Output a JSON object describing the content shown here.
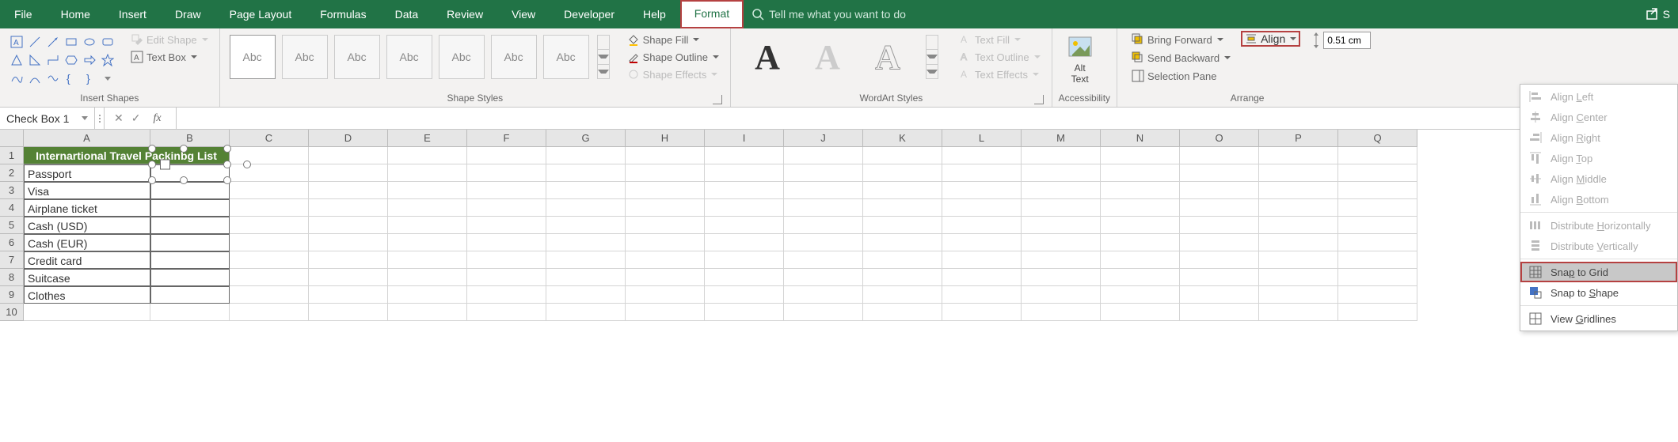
{
  "menu": {
    "tabs": [
      "File",
      "Home",
      "Insert",
      "Draw",
      "Page Layout",
      "Formulas",
      "Data",
      "Review",
      "View",
      "Developer",
      "Help",
      "Format"
    ],
    "active": "Format",
    "tellme_placeholder": "Tell me what you want to do",
    "share": "S"
  },
  "ribbon": {
    "insert_shapes": {
      "edit_shape": "Edit Shape",
      "text_box": "Text Box",
      "label": "Insert Shapes"
    },
    "shape_styles": {
      "swatch_text": "Abc",
      "fill": "Shape Fill",
      "outline": "Shape Outline",
      "effects": "Shape Effects",
      "label": "Shape Styles"
    },
    "wordart": {
      "glyph": "A",
      "fill": "Text Fill",
      "outline": "Text Outline",
      "effects": "Text Effects",
      "label": "WordArt Styles"
    },
    "accessibility": {
      "alt": "Alt\nText",
      "label": "Accessibility"
    },
    "arrange": {
      "bring_forward": "Bring Forward",
      "send_backward": "Send Backward",
      "selection_pane": "Selection Pane",
      "align": "Align",
      "label": "Arrange"
    },
    "size": {
      "height": "0.51 cm"
    }
  },
  "align_menu": {
    "items": [
      {
        "label": "Align Left",
        "u": "L"
      },
      {
        "label": "Align Center",
        "u": "C"
      },
      {
        "label": "Align Right",
        "u": "R"
      },
      {
        "label": "Align Top",
        "u": "T"
      },
      {
        "label": "Align Middle",
        "u": "M"
      },
      {
        "label": "Align Bottom",
        "u": "B"
      },
      {
        "label": "Distribute Horizontally",
        "u": "H"
      },
      {
        "label": "Distribute Vertically",
        "u": "V"
      },
      {
        "label": "Snap to Grid",
        "u": "P"
      },
      {
        "label": "Snap to Shape",
        "u": "S"
      },
      {
        "label": "View Gridlines",
        "u": "G"
      }
    ]
  },
  "formula_bar": {
    "name": "Check Box 1",
    "fx": "fx"
  },
  "sheet": {
    "cols": [
      "A",
      "B",
      "C",
      "D",
      "E",
      "F",
      "G",
      "H",
      "I",
      "J",
      "K",
      "L",
      "M",
      "N",
      "O",
      "P",
      "Q"
    ],
    "header": "Internartional Travel Packinbg List",
    "rows": [
      "Passport",
      "Visa",
      "Airplane ticket",
      "Cash (USD)",
      "Cash (EUR)",
      "Credit card",
      "Suitcase",
      "Clothes"
    ]
  }
}
